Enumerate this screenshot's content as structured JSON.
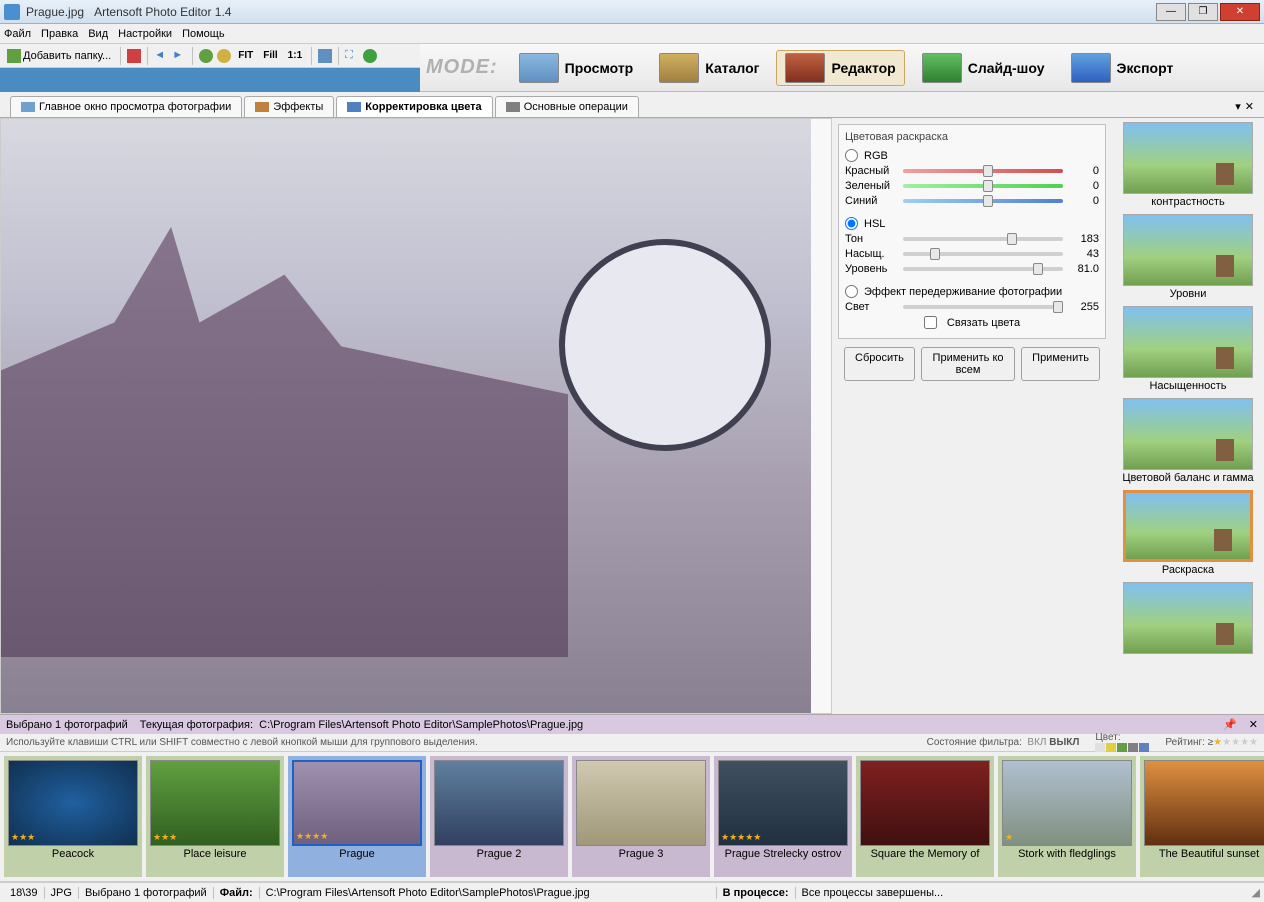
{
  "title": {
    "file": "Prague.jpg",
    "app": "Artensoft Photo Editor 1.4"
  },
  "menu": [
    "Файл",
    "Правка",
    "Вид",
    "Настройки",
    "Помощь"
  ],
  "toolbar": {
    "addFolder": "Добавить папку...",
    "fit": "FIT",
    "fill": "Fill",
    "oneToOne": "1:1"
  },
  "modeLabel": "MODE:",
  "modes": [
    {
      "label": "Просмотр",
      "active": false
    },
    {
      "label": "Каталог",
      "active": false
    },
    {
      "label": "Редактор",
      "active": true
    },
    {
      "label": "Слайд-шоу",
      "active": false
    },
    {
      "label": "Экспорт",
      "active": false
    }
  ],
  "tabs": [
    {
      "label": "Главное окно просмотра фотографии",
      "active": false
    },
    {
      "label": "Эффекты",
      "active": false
    },
    {
      "label": "Корректировка цвета",
      "active": true
    },
    {
      "label": "Основные операции",
      "active": false
    }
  ],
  "colorPanel": {
    "title": "Цветовая раскраска",
    "rgb": {
      "label": "RGB",
      "selected": false,
      "channels": [
        {
          "label": "Красный",
          "value": 0,
          "class": "red"
        },
        {
          "label": "Зеленый",
          "value": 0,
          "class": "green"
        },
        {
          "label": "Синий",
          "value": 0,
          "class": "blue"
        }
      ]
    },
    "hsl": {
      "label": "HSL",
      "selected": true,
      "channels": [
        {
          "label": "Тон",
          "value": 183,
          "pct": 65
        },
        {
          "label": "Насыщ.",
          "value": 43,
          "pct": 17
        },
        {
          "label": "Уровень",
          "value": "81.0",
          "pct": 81
        }
      ]
    },
    "overexpose": {
      "label": "Эффект передерживание фотографии",
      "light": {
        "label": "Свет",
        "value": 255,
        "pct": 100
      },
      "link": "Связать цвета"
    },
    "buttons": {
      "reset": "Сбросить",
      "applyAll": "Применить ко всем",
      "apply": "Применить"
    }
  },
  "presets": [
    {
      "label": "контрастность",
      "sel": false
    },
    {
      "label": "Уровни",
      "sel": false
    },
    {
      "label": "Насыщенность",
      "sel": false
    },
    {
      "label": "Цветовой баланс и гамма",
      "sel": false
    },
    {
      "label": "Раскраска",
      "sel": true
    },
    {
      "label": "",
      "sel": false
    }
  ],
  "infobar": {
    "selected": "Выбрано 1  фотографий",
    "currentLabel": "Текущая фотография:",
    "currentPath": "C:\\Program Files\\Artensoft Photo Editor\\SamplePhotos\\Prague.jpg"
  },
  "thumbInfo": {
    "hint": "Используйте клавиши CTRL или SHIFT совместно с левой кнопкой мыши для группового выделения.",
    "filterStateLabel": "Состояние фильтра:",
    "on": "ВКЛ",
    "off": "ВЫКЛ",
    "colorLabel": "Цвет:",
    "ratingLabel": "Рейтинг: ≥"
  },
  "thumbs": [
    {
      "label": "Peacock",
      "sel": false,
      "cls": ""
    },
    {
      "label": "Place leisure",
      "sel": false,
      "cls": ""
    },
    {
      "label": "Prague",
      "sel": true,
      "cls": "sel"
    },
    {
      "label": "Prague 2",
      "sel": false,
      "cls": "alt"
    },
    {
      "label": "Prague 3",
      "sel": false,
      "cls": "alt"
    },
    {
      "label": "Prague Strelecky ostrov",
      "sel": false,
      "cls": "alt"
    },
    {
      "label": "Square the Memory of",
      "sel": false,
      "cls": ""
    },
    {
      "label": "Stork with fledglings",
      "sel": false,
      "cls": ""
    },
    {
      "label": "The Beautiful sunset",
      "sel": false,
      "cls": ""
    }
  ],
  "statusbar": {
    "counter": "18\\39",
    "format": "JPG",
    "selected": "Выбрано 1 фотографий",
    "fileLabel": "Файл:",
    "filePath": "C:\\Program Files\\Artensoft Photo Editor\\SamplePhotos\\Prague.jpg",
    "processLabel": "В процессе:",
    "processText": "Все процессы завершены..."
  },
  "colors": {
    "accent": "#e09040",
    "selBlue": "#4a90d0"
  }
}
